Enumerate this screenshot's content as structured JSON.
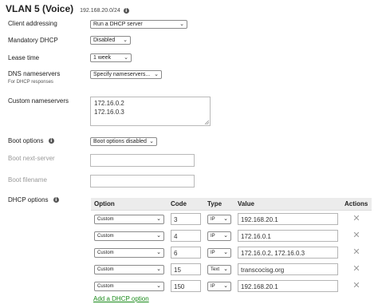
{
  "header": {
    "title": "VLAN 5 (Voice)",
    "subnet": "192.168.20.0/24",
    "info_icon": "i"
  },
  "form": {
    "client_addressing": {
      "label": "Client addressing",
      "value": "Run a DHCP server"
    },
    "mandatory_dhcp": {
      "label": "Mandatory DHCP",
      "value": "Disabled"
    },
    "lease_time": {
      "label": "Lease time",
      "value": "1 week"
    },
    "dns_nameservers": {
      "label": "DNS nameservers",
      "sublabel": "For DHCP responses",
      "value": "Specify nameservers..."
    },
    "custom_nameservers": {
      "label": "Custom nameservers",
      "lines": [
        "172.16.0.2",
        "172.16.0.3"
      ]
    },
    "boot_options": {
      "label": "Boot options",
      "value": "Boot options disabled"
    },
    "boot_next_server": {
      "label": "Boot next-server",
      "value": ""
    },
    "boot_filename": {
      "label": "Boot filename",
      "value": ""
    },
    "dhcp_options_label": "DHCP options"
  },
  "dhcp_table": {
    "columns": [
      "Option",
      "Code",
      "Type",
      "Value",
      "Actions"
    ],
    "rows": [
      {
        "option": "Custom",
        "code": "3",
        "type": "IP",
        "value": "192.168.20.1"
      },
      {
        "option": "Custom",
        "code": "4",
        "type": "IP",
        "value": "172.16.0.1"
      },
      {
        "option": "Custom",
        "code": "6",
        "type": "IP",
        "value": "172.16.0.2, 172.16.0.3"
      },
      {
        "option": "Custom",
        "code": "15",
        "type": "Text",
        "value": "transcocisg.org"
      },
      {
        "option": "Custom",
        "code": "150",
        "type": "IP",
        "value": "192.168.20.1"
      }
    ],
    "delete_glyph": "✕",
    "add_link": "Add a DHCP option"
  },
  "icons": {
    "dropdown": "chevron-down-icon",
    "delete": "close-icon",
    "info": "info-icon"
  },
  "colors": {
    "link": "#1a8a1a",
    "header_bg": "#ececec",
    "disabled_text": "#9a9a9a"
  }
}
